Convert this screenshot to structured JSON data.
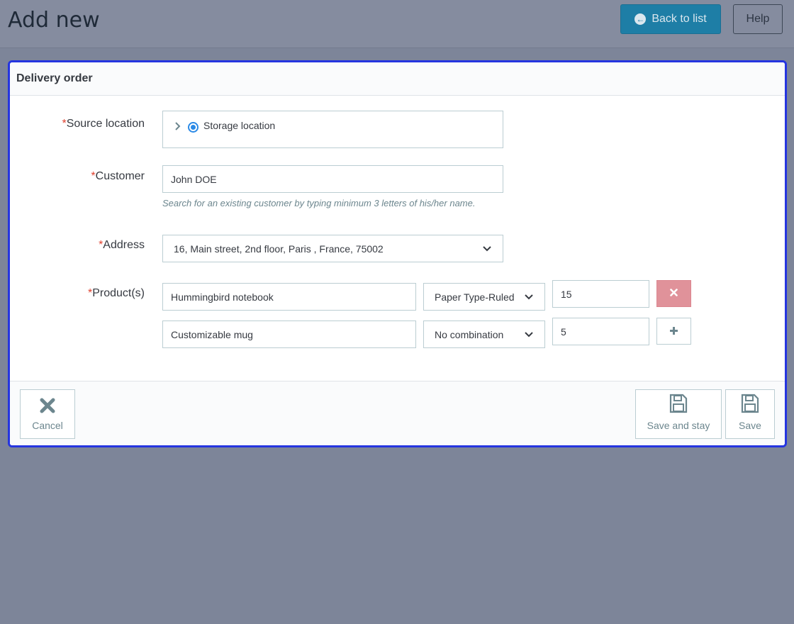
{
  "header": {
    "title": "Add new",
    "back_label": "Back to list",
    "help_label": "Help"
  },
  "form": {
    "card_title": "Delivery order",
    "required_mark": "*",
    "source_location": {
      "label": "Source location",
      "option": "Storage location"
    },
    "customer": {
      "label": "Customer",
      "value": "John DOE",
      "help": "Search for an existing customer by typing minimum 3 letters of his/her name."
    },
    "address": {
      "label": "Address",
      "value": "16, Main street, 2nd floor, Paris , France, 75002"
    },
    "products": {
      "label": "Product(s)",
      "rows": [
        {
          "name": "Hummingbird notebook",
          "combination": "Paper Type-Ruled",
          "quantity": "15"
        },
        {
          "name": "Customizable mug",
          "combination": "No combination",
          "quantity": "5"
        }
      ]
    }
  },
  "footer": {
    "cancel_label": "Cancel",
    "save_and_stay_label": "Save and stay",
    "save_label": "Save"
  },
  "colors": {
    "accent": "#1e7ea6",
    "card_border": "#2535e0",
    "required": "#e0412f",
    "remove_button": "#e0929a"
  }
}
